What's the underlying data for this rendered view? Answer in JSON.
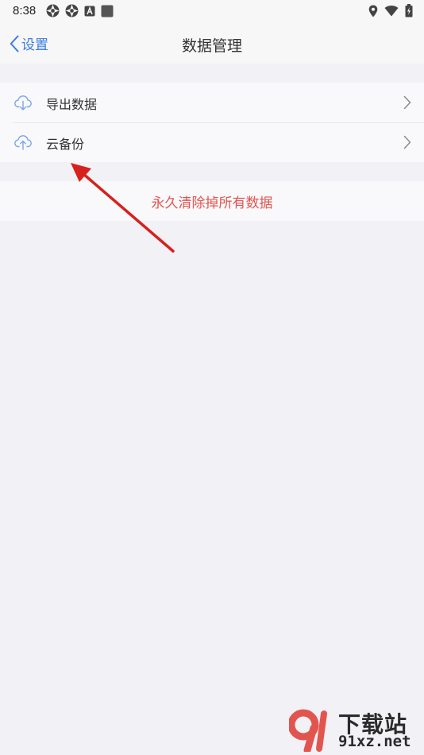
{
  "status_bar": {
    "time": "8:38"
  },
  "nav": {
    "back_label": "设置",
    "title": "数据管理"
  },
  "menu_group": {
    "items": [
      {
        "label": "导出数据",
        "icon": "cloud-download-icon"
      },
      {
        "label": "云备份",
        "icon": "cloud-upload-icon"
      }
    ]
  },
  "danger": {
    "label": "永久清除掉所有数据"
  },
  "watermark": {
    "title": "下载站",
    "site": "91xz.net"
  },
  "colors": {
    "accent": "#3b7be0",
    "danger": "#e2554f",
    "arrow": "#d6211c",
    "background": "#f2f1f6"
  }
}
